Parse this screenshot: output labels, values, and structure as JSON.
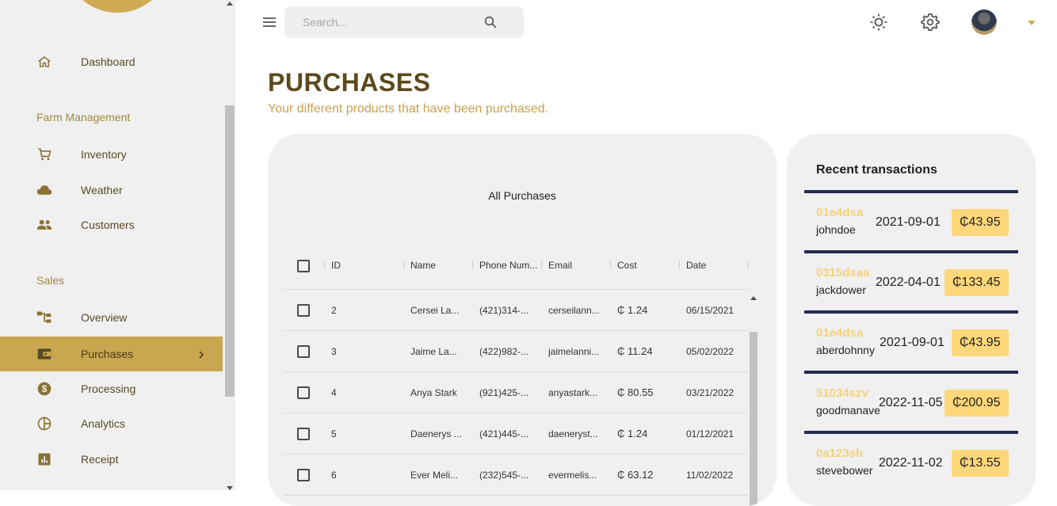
{
  "sidebar": {
    "items": [
      {
        "label": "Dashboard",
        "icon": "home-icon"
      },
      {
        "label": "Inventory",
        "icon": "cart-icon"
      },
      {
        "label": "Weather",
        "icon": "cloud-icon"
      },
      {
        "label": "Customers",
        "icon": "people-icon"
      },
      {
        "label": "Overview",
        "icon": "org-chart-icon"
      },
      {
        "label": "Purchases",
        "icon": "wallet-icon",
        "active": true
      },
      {
        "label": "Processing",
        "icon": "dollar-coin-icon"
      },
      {
        "label": "Analytics",
        "icon": "pie-chart-icon"
      },
      {
        "label": "Receipt",
        "icon": "receipt-bar-icon"
      }
    ],
    "sections": {
      "farm": "Farm Management",
      "sales": "Sales"
    }
  },
  "topbar": {
    "search_placeholder": "Search...",
    "icons": [
      "menu-icon",
      "search-icon",
      "light-mode-icon",
      "settings-icon",
      "avatar",
      "dropdown-arrow-icon"
    ]
  },
  "page": {
    "title": "PURCHASES",
    "subtitle": "Your different products that have been purchased."
  },
  "grid": {
    "title": "All Purchases",
    "columns": [
      "ID",
      "Name",
      "Phone Num...",
      "Email",
      "Cost",
      "Date"
    ],
    "rows": [
      {
        "id": "2",
        "name": "Cersei La...",
        "phone": "(421)314-...",
        "email": "cerseilann...",
        "cost": "₵ 1.24",
        "date": "06/15/2021"
      },
      {
        "id": "3",
        "name": "Jaime La...",
        "phone": "(422)982-...",
        "email": "jaimelanni...",
        "cost": "₵ 11.24",
        "date": "05/02/2022"
      },
      {
        "id": "4",
        "name": "Anya Stark",
        "phone": "(921)425-...",
        "email": "anyastark...",
        "cost": "₵ 80.55",
        "date": "03/21/2022"
      },
      {
        "id": "5",
        "name": "Daenerys ...",
        "phone": "(421)445-...",
        "email": "daeneryst...",
        "cost": "₵ 1.24",
        "date": "01/12/2021"
      },
      {
        "id": "6",
        "name": "Ever Meli...",
        "phone": "(232)545-...",
        "email": "evermelis...",
        "cost": "₵ 63.12",
        "date": "11/02/2022"
      }
    ]
  },
  "transactions": {
    "title": "Recent transactions",
    "items": [
      {
        "txid": "01e4dsa",
        "user": "johndoe",
        "date": "2021-09-01",
        "amount": "₵43.95"
      },
      {
        "txid": "0315dsaa",
        "user": "jackdower",
        "date": "2022-04-01",
        "amount": "₵133.45"
      },
      {
        "txid": "01e4dsa",
        "user": "aberdohnny",
        "date": "2021-09-01",
        "amount": "₵43.95"
      },
      {
        "txid": "51034szv",
        "user": "goodmanave",
        "date": "2022-11-05",
        "amount": "₵200.95"
      },
      {
        "txid": "0a123sb",
        "user": "stevebower",
        "date": "2022-11-02",
        "amount": "₵13.55"
      }
    ]
  },
  "colors": {
    "accent": "#c9a650",
    "title": "#5c4a1e",
    "subtitle": "#c9a24e",
    "tx_border": "#232c52",
    "tx_id": "#f5d27a",
    "amount_bg": "#fdd779"
  }
}
